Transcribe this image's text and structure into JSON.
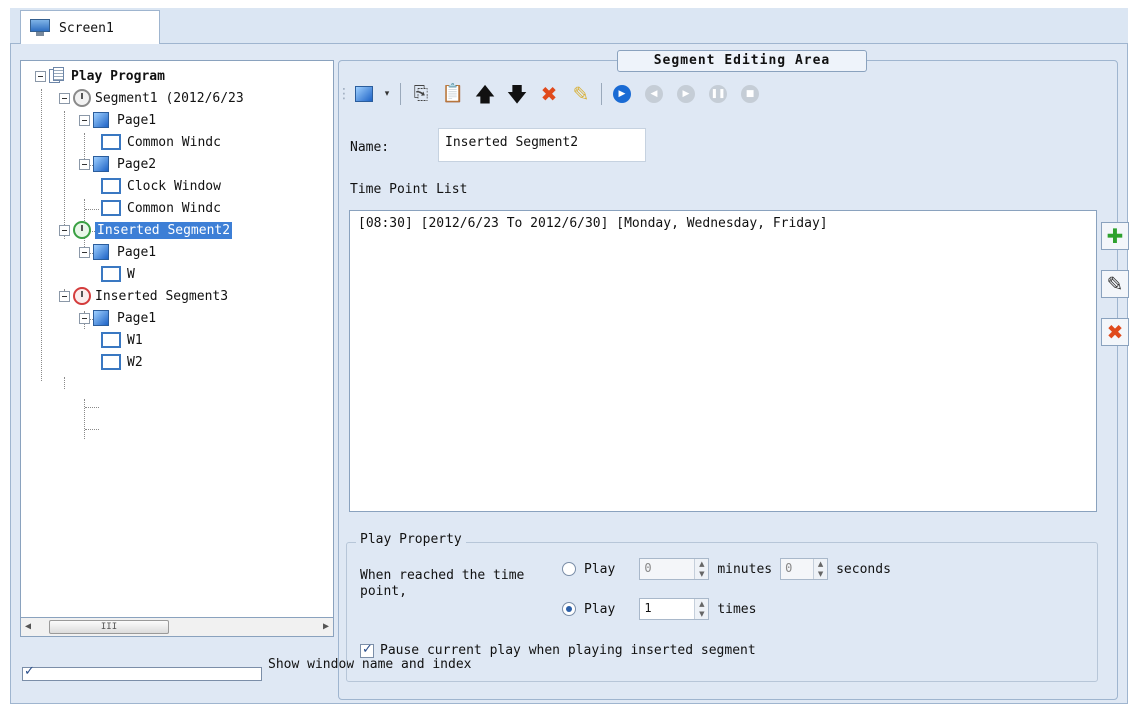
{
  "tab": {
    "label": "Screen1",
    "icon": "monitor-icon"
  },
  "tree": {
    "root": "Play Program",
    "nodes": [
      {
        "label": "Segment1 (2012/6/23",
        "icon": "clock-icon"
      },
      {
        "label": "Page1",
        "icon": "page-icon"
      },
      {
        "label": "Common Windc",
        "icon": "window-icon"
      },
      {
        "label": "Page2",
        "icon": "page-icon"
      },
      {
        "label": "Clock Window",
        "icon": "window-icon"
      },
      {
        "label": "Common Windc",
        "icon": "window-icon"
      },
      {
        "label": "Inserted Segment2",
        "icon": "clock-green-icon",
        "selected": true
      },
      {
        "label": "Page1",
        "icon": "page-icon"
      },
      {
        "label": "W",
        "icon": "window-icon"
      },
      {
        "label": "Inserted Segment3",
        "icon": "clock-red-icon"
      },
      {
        "label": "Page1",
        "icon": "page-icon"
      },
      {
        "label": "W1",
        "icon": "window-icon"
      },
      {
        "label": "W2",
        "icon": "window-icon"
      }
    ]
  },
  "scroll": {
    "left": "◀",
    "grip": "III",
    "right": "▶"
  },
  "show_window": {
    "label": "Show window name and index",
    "checked": true
  },
  "edit": {
    "title": "Segment Editing Area",
    "name_label": "Name:",
    "name_value": "Inserted Segment2",
    "time_point_label": "Time Point List",
    "time_points": [
      "[08:30] [2012/6/23 To 2012/6/30] [Monday, Wednesday, Friday]"
    ]
  },
  "toolbar": {
    "icons": [
      "new-page-icon",
      "dropdown-icon",
      "copy-icon",
      "paste-icon",
      "move-up-icon",
      "move-down-icon",
      "delete-icon",
      "clear-icon",
      "play-icon",
      "prev-icon",
      "next-icon",
      "pause-icon",
      "stop-icon"
    ]
  },
  "side_buttons": [
    "add-icon",
    "edit-icon",
    "delete-icon"
  ],
  "play_property": {
    "title": "Play Property",
    "when_text": "When reached the time point,",
    "opt1_label": "Play",
    "opt1_minutes": "0",
    "minutes_label": "minutes",
    "opt1_seconds": "0",
    "seconds_label": "seconds",
    "opt2_label": "Play",
    "opt2_times": "1",
    "times_label": "times",
    "selected_option": 2,
    "pause_label": "Pause current play when playing inserted segment",
    "pause_checked": true
  },
  "colors": {
    "selection": "#3d7fd6",
    "panel_bg": "#dfe8f4",
    "border": "#8aa2be"
  }
}
